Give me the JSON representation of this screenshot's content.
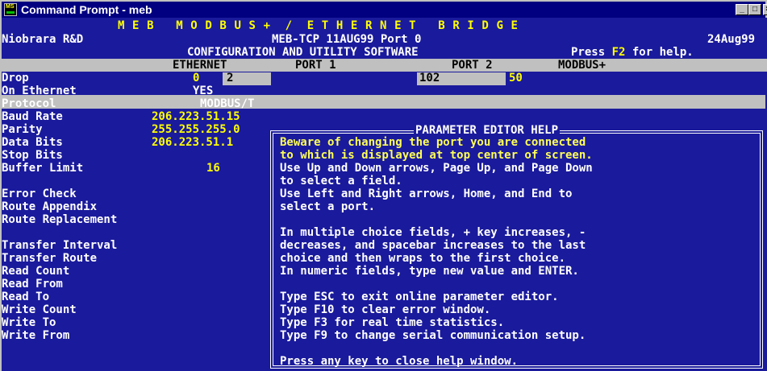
{
  "window": {
    "title": "Command Prompt - meb",
    "min_label": "_",
    "max_label": "□",
    "close_label": "×"
  },
  "banner": {
    "line1": "M E B   M O D B U S +  /  E T H E R N E T   B R I D G E",
    "line2_left": "Niobrara R&D",
    "line2_center": "MEB-TCP 11AUG99 Port 0",
    "line2_right": "24Aug99",
    "line3_center": "CONFIGURATION AND UTILITY SOFTWARE",
    "line3_right_a": "Press ",
    "line3_right_key": "F2",
    "line3_right_b": " for help."
  },
  "columns": {
    "ethernet": "ETHERNET",
    "port1": "PORT 1",
    "port2": "PORT 2",
    "modbus": "MODBUS+"
  },
  "rows": [
    {
      "label": "Drop",
      "ethernet": "0",
      "port1": "2",
      "port2": "102",
      "modbus": "50"
    },
    {
      "label": "On Ethernet",
      "ethernet": "YES"
    },
    {
      "label": "Protocol",
      "ethernet": "MODBUS/T"
    },
    {
      "label": "Baud Rate",
      "ethernet": "206.223.51.15"
    },
    {
      "label": "Parity",
      "ethernet": "255.255.255.0"
    },
    {
      "label": "Data Bits",
      "ethernet": "206.223.51.1"
    },
    {
      "label": "Stop Bits"
    },
    {
      "label": "Buffer Limit",
      "ethernet": "16"
    },
    {
      "label": ""
    },
    {
      "label": "Error Check"
    },
    {
      "label": "Route Appendix"
    },
    {
      "label": "Route Replacement"
    },
    {
      "label": ""
    },
    {
      "label": "Transfer Interval"
    },
    {
      "label": "Transfer Route"
    },
    {
      "label": "Read Count"
    },
    {
      "label": "Read From"
    },
    {
      "label": "Read To"
    },
    {
      "label": "Write Count"
    },
    {
      "label": "Write To"
    },
    {
      "label": "Write From"
    }
  ],
  "help": {
    "title": "PARAMETER EDITOR HELP",
    "lines": [
      "Beware of changing the port you are connected",
      "to which is displayed at top center of screen.",
      "Use Up and Down arrows, Page Up, and Page Down",
      "to select a field.",
      "Use Left and Right arrows, Home, and End to",
      "select a port.",
      "",
      "In multiple choice fields, + key increases, -",
      "decreases, and spacebar increases to the last",
      "choice and then wraps to the first choice.",
      "In numeric fields, type new value and ENTER.",
      "",
      "Type ESC to exit online parameter editor.",
      "Type F10 to clear error window.",
      "Type F3 for real time statistics.",
      "Type F9 to change serial communication setup.",
      "",
      "Press any key to close help window."
    ]
  },
  "colors": {
    "console_bg": "#1a1a9c",
    "title_bar": "#000080",
    "highlight": "#ffff00"
  }
}
